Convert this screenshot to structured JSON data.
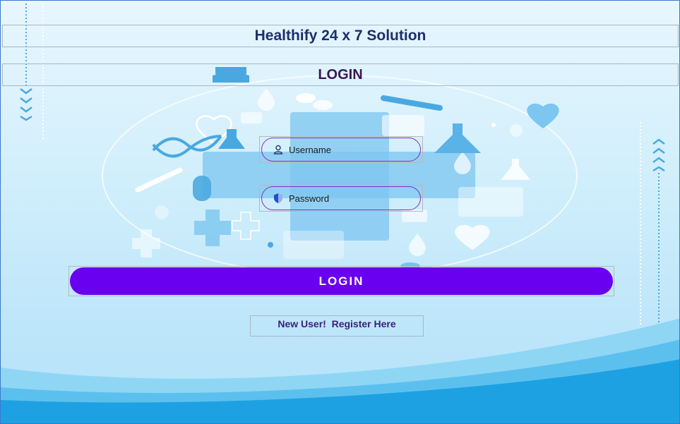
{
  "header": {
    "title": "Healthify 24 x 7 Solution"
  },
  "subheader": {
    "title": "LOGIN"
  },
  "form": {
    "username": {
      "placeholder": "Username",
      "value": ""
    },
    "password": {
      "placeholder": "Password",
      "value": ""
    }
  },
  "login_button": {
    "label": "LOGIN"
  },
  "register_link": {
    "label": "New User!  Register Here"
  },
  "icons": {
    "username_icon": "user-icon",
    "password_icon": "shield-icon",
    "scroll_down": "chevrons-down-icon",
    "scroll_up": "chevrons-up-icon"
  },
  "colors": {
    "accent": "#6a00f0",
    "field_border": "#8a2db8",
    "title": "#1c2f6b",
    "subtitle": "#3a1656",
    "wave": "#1da1e2"
  }
}
